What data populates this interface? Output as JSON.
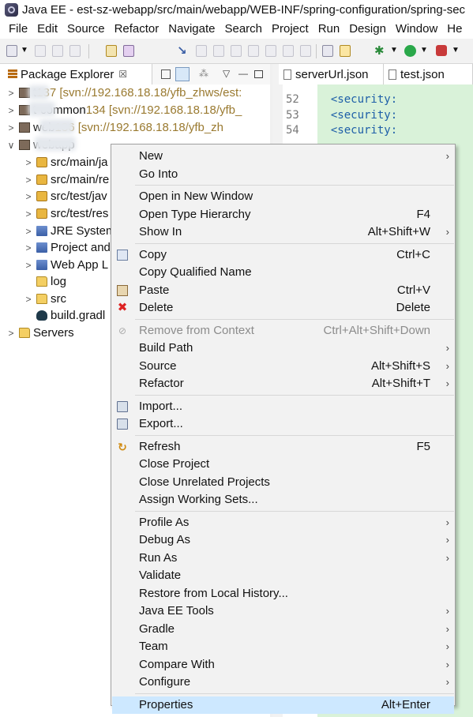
{
  "window": {
    "title": "Java EE - est-sz-webapp/src/main/webapp/WEB-INF/spring-configuration/spring-sec"
  },
  "menubar": [
    "File",
    "Edit",
    "Source",
    "Refactor",
    "Navigate",
    "Search",
    "Project",
    "Run",
    "Design",
    "Window",
    "He"
  ],
  "package_explorer": {
    "title": "Package Explorer",
    "close_glyph": "☒",
    "rows": [
      {
        "chevron": ">",
        "icon": "project-icon",
        "name": "t",
        "svn": " 137 [svn://192.168.18.18/yfb_zhws/est:"
      },
      {
        "chevron": ">",
        "icon": "project-icon",
        "name": "t-common",
        "svn": " 134 [svn://192.168.18.18/yfb_"
      },
      {
        "chevron": ">",
        "icon": "project-icon",
        "name": "web",
        "svn": " 136 [svn://192.168.18.18/yfb_zh"
      },
      {
        "chevron": "∨",
        "icon": "project-icon",
        "name": "webapp",
        "svn": ""
      },
      {
        "chevron": ">",
        "icon": "package-folder-icon",
        "name": "src/main/ja",
        "svn": ""
      },
      {
        "chevron": ">",
        "icon": "package-folder-icon",
        "name": "src/main/re",
        "svn": ""
      },
      {
        "chevron": ">",
        "icon": "package-folder-icon",
        "name": "src/test/jav",
        "svn": ""
      },
      {
        "chevron": ">",
        "icon": "package-folder-icon",
        "name": "src/test/res",
        "svn": ""
      },
      {
        "chevron": ">",
        "icon": "library-icon",
        "name": "JRE System",
        "svn": ""
      },
      {
        "chevron": ">",
        "icon": "library-icon",
        "name": "Project and",
        "svn": ""
      },
      {
        "chevron": ">",
        "icon": "library-icon",
        "name": "Web App L",
        "svn": ""
      },
      {
        "chevron": "",
        "icon": "folder-icon",
        "name": "log",
        "svn": ""
      },
      {
        "chevron": ">",
        "icon": "folder-icon",
        "name": "src",
        "svn": ""
      },
      {
        "chevron": "",
        "icon": "gradle-icon",
        "name": "build.gradl",
        "svn": ""
      },
      {
        "chevron": ">",
        "icon": "folder-icon",
        "name": "Servers",
        "svn": ""
      }
    ]
  },
  "editor": {
    "tabs": [
      "serverUrl.json",
      "test.json"
    ],
    "line_numbers": [
      "52",
      "53",
      "54"
    ],
    "code_lines": [
      "  <security:",
      "  <security:",
      "  <security:"
    ]
  },
  "context_menu": {
    "items": [
      {
        "label": "New",
        "shortcut": "",
        "submenu": true,
        "icon": "",
        "disabled": false
      },
      {
        "label": "Go Into",
        "shortcut": "",
        "submenu": false,
        "icon": "",
        "disabled": false
      },
      {
        "sep": true
      },
      {
        "label": "Open in New Window",
        "shortcut": "",
        "submenu": false,
        "icon": "",
        "disabled": false
      },
      {
        "label": "Open Type Hierarchy",
        "shortcut": "F4",
        "submenu": false,
        "icon": "",
        "disabled": false
      },
      {
        "label": "Show In",
        "shortcut": "Alt+Shift+W",
        "submenu": true,
        "icon": "",
        "disabled": false
      },
      {
        "sep": true
      },
      {
        "label": "Copy",
        "shortcut": "Ctrl+C",
        "submenu": false,
        "icon": "copy-icon",
        "disabled": false
      },
      {
        "label": "Copy Qualified Name",
        "shortcut": "",
        "submenu": false,
        "icon": "",
        "disabled": false
      },
      {
        "label": "Paste",
        "shortcut": "Ctrl+V",
        "submenu": false,
        "icon": "paste-icon",
        "disabled": false
      },
      {
        "label": "Delete",
        "shortcut": "Delete",
        "submenu": false,
        "icon": "delete-icon",
        "disabled": false
      },
      {
        "sep": true
      },
      {
        "label": "Remove from Context",
        "shortcut": "Ctrl+Alt+Shift+Down",
        "submenu": false,
        "icon": "remove-context-icon",
        "disabled": true
      },
      {
        "label": "Build Path",
        "shortcut": "",
        "submenu": true,
        "icon": "",
        "disabled": false
      },
      {
        "label": "Source",
        "shortcut": "Alt+Shift+S",
        "submenu": true,
        "icon": "",
        "disabled": false
      },
      {
        "label": "Refactor",
        "shortcut": "Alt+Shift+T",
        "submenu": true,
        "icon": "",
        "disabled": false
      },
      {
        "sep": true
      },
      {
        "label": "Import...",
        "shortcut": "",
        "submenu": false,
        "icon": "import-icon",
        "disabled": false
      },
      {
        "label": "Export...",
        "shortcut": "",
        "submenu": false,
        "icon": "export-icon",
        "disabled": false
      },
      {
        "sep": true
      },
      {
        "label": "Refresh",
        "shortcut": "F5",
        "submenu": false,
        "icon": "refresh-icon",
        "disabled": false
      },
      {
        "label": "Close Project",
        "shortcut": "",
        "submenu": false,
        "icon": "",
        "disabled": false
      },
      {
        "label": "Close Unrelated Projects",
        "shortcut": "",
        "submenu": false,
        "icon": "",
        "disabled": false
      },
      {
        "label": "Assign Working Sets...",
        "shortcut": "",
        "submenu": false,
        "icon": "",
        "disabled": false
      },
      {
        "sep": true
      },
      {
        "label": "Profile As",
        "shortcut": "",
        "submenu": true,
        "icon": "",
        "disabled": false
      },
      {
        "label": "Debug As",
        "shortcut": "",
        "submenu": true,
        "icon": "",
        "disabled": false
      },
      {
        "label": "Run As",
        "shortcut": "",
        "submenu": true,
        "icon": "",
        "disabled": false
      },
      {
        "label": "Validate",
        "shortcut": "",
        "submenu": false,
        "icon": "",
        "disabled": false
      },
      {
        "label": "Restore from Local History...",
        "shortcut": "",
        "submenu": false,
        "icon": "",
        "disabled": false
      },
      {
        "label": "Java EE Tools",
        "shortcut": "",
        "submenu": true,
        "icon": "",
        "disabled": false
      },
      {
        "label": "Gradle",
        "shortcut": "",
        "submenu": true,
        "icon": "",
        "disabled": false
      },
      {
        "label": "Team",
        "shortcut": "",
        "submenu": true,
        "icon": "",
        "disabled": false
      },
      {
        "label": "Compare With",
        "shortcut": "",
        "submenu": true,
        "icon": "",
        "disabled": false
      },
      {
        "label": "Configure",
        "shortcut": "",
        "submenu": true,
        "icon": "",
        "disabled": false
      },
      {
        "sep": true
      },
      {
        "label": "Properties",
        "shortcut": "Alt+Enter",
        "submenu": false,
        "icon": "",
        "disabled": false,
        "highlighted": true
      }
    ]
  }
}
